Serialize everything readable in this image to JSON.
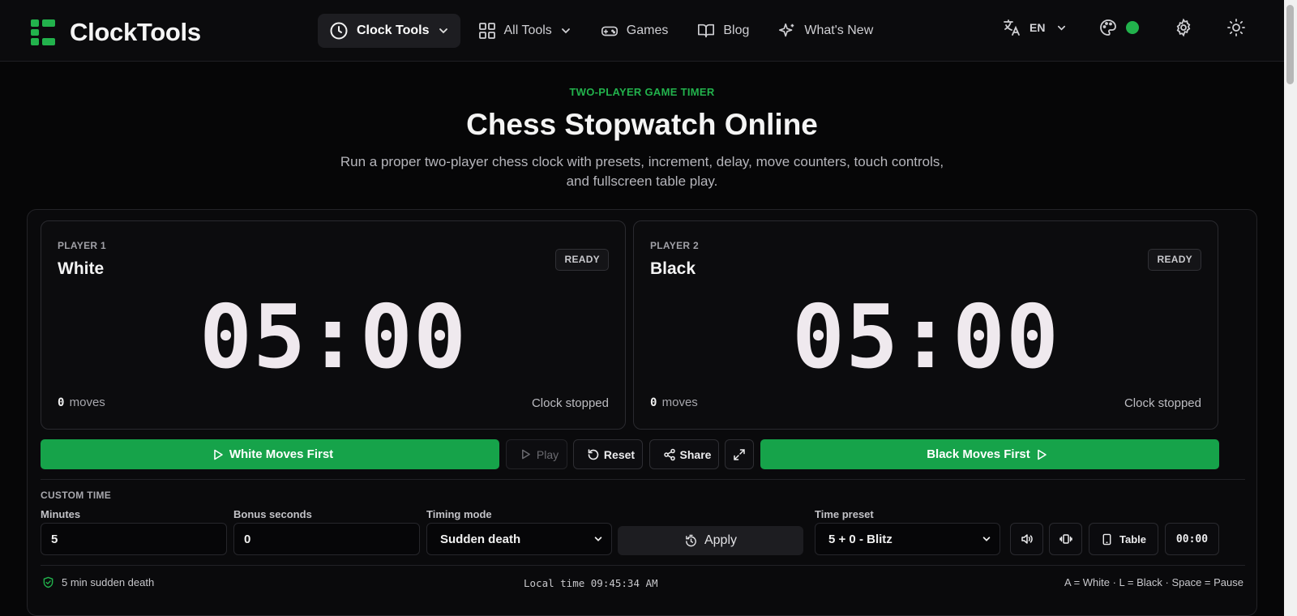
{
  "brand": {
    "name": "ClockTools",
    "color": "#22b24c"
  },
  "nav": {
    "items": [
      {
        "label": "Clock Tools",
        "icon": "clock-icon",
        "active": true,
        "dropdown": true
      },
      {
        "label": "All Tools",
        "icon": "grid-icon",
        "active": false,
        "dropdown": true
      },
      {
        "label": "Games",
        "icon": "gamepad-icon",
        "active": false,
        "dropdown": false
      },
      {
        "label": "Blog",
        "icon": "book-icon",
        "active": false,
        "dropdown": false
      },
      {
        "label": "What's New",
        "icon": "sparkles-icon",
        "active": false,
        "dropdown": false
      }
    ],
    "language": "EN",
    "status_color": "#22b24c"
  },
  "hero": {
    "eyebrow": "TWO-PLAYER GAME TIMER",
    "title": "Chess Stopwatch Online",
    "subtitle": "Run a proper two-player chess clock with presets, increment, delay, move counters, touch controls, and fullscreen table play."
  },
  "players": [
    {
      "tag": "PLAYER 1",
      "name": "White",
      "badge": "READY",
      "time": "05:00",
      "moves": "0",
      "moves_label": "moves",
      "status": "Clock stopped"
    },
    {
      "tag": "PLAYER 2",
      "name": "Black",
      "badge": "READY",
      "time": "05:00",
      "moves": "0",
      "moves_label": "moves",
      "status": "Clock stopped"
    }
  ],
  "controls": {
    "white_first": "White Moves First",
    "play": "Play",
    "reset": "Reset",
    "share": "Share",
    "black_first": "Black Moves First",
    "accent": "#16a34a"
  },
  "custom_time": {
    "title": "CUSTOM TIME",
    "minutes_label": "Minutes",
    "minutes_value": "5",
    "bonus_label": "Bonus seconds",
    "bonus_value": "0",
    "mode_label": "Timing mode",
    "mode_value": "Sudden death",
    "apply": "Apply",
    "preset_label": "Time preset",
    "preset_value": "5 + 0 - Blitz",
    "table_label": "Table",
    "mini_time": "00:00"
  },
  "footer": {
    "summary": "5 min sudden death",
    "local_time": "Local time 09:45:34 AM",
    "shortcuts": "A = White · L = Black · Space = Pause"
  }
}
